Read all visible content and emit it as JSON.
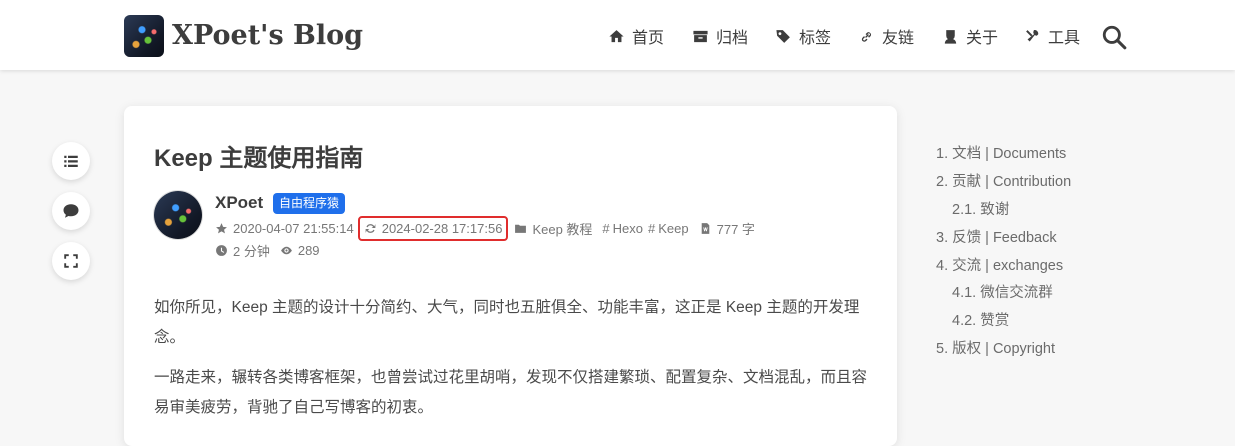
{
  "site": {
    "title": "XPoet's Blog"
  },
  "nav": [
    {
      "label": "首页",
      "icon": "home-icon"
    },
    {
      "label": "归档",
      "icon": "archive-icon"
    },
    {
      "label": "标签",
      "icon": "tags-icon"
    },
    {
      "label": "友链",
      "icon": "link-icon"
    },
    {
      "label": "关于",
      "icon": "user-tie-icon"
    },
    {
      "label": "工具",
      "icon": "tools-icon"
    }
  ],
  "tools": [
    {
      "icon": "toc-list-icon"
    },
    {
      "icon": "comment-icon"
    },
    {
      "icon": "fullscreen-icon"
    }
  ],
  "post": {
    "title": "Keep 主题使用指南",
    "author": "XPoet",
    "author_badge": "自由程序猿",
    "created": "2020-04-07 21:55:14",
    "updated": "2024-02-28 17:17:56",
    "category": "Keep 教程",
    "tags": [
      "Hexo",
      "Keep"
    ],
    "word_count": "777 字",
    "read_time": "2 分钟",
    "views": "289",
    "paragraphs": [
      {
        "line1": "如你所见，Keep 主题的设计十分简约、大气，同时也五脏俱全、功能丰富，这正是 Keep 主题的开发理",
        "line2": "念。"
      },
      {
        "line1": "一路走来，辗转各类博客框架，也曾尝试过花里胡哨，发现不仅搭建繁琐、配置复杂、文档混乱，而且容",
        "line2": "易审美疲劳，背驰了自己写博客的初衷。"
      }
    ]
  },
  "toc": [
    {
      "label": "1. 文档 | Documents"
    },
    {
      "label": "2. 贡献 | Contribution"
    },
    {
      "label": "2.1. 致谢"
    },
    {
      "label": "3. 反馈 | Feedback"
    },
    {
      "label": "4. 交流 | exchanges"
    },
    {
      "label": "4.1. 微信交流群"
    },
    {
      "label": "4.2. 赞赏"
    },
    {
      "label": "5. 版权 | Copyright"
    }
  ],
  "colors": {
    "badge": "#1f6feb",
    "highlight": "#e02d2d"
  }
}
